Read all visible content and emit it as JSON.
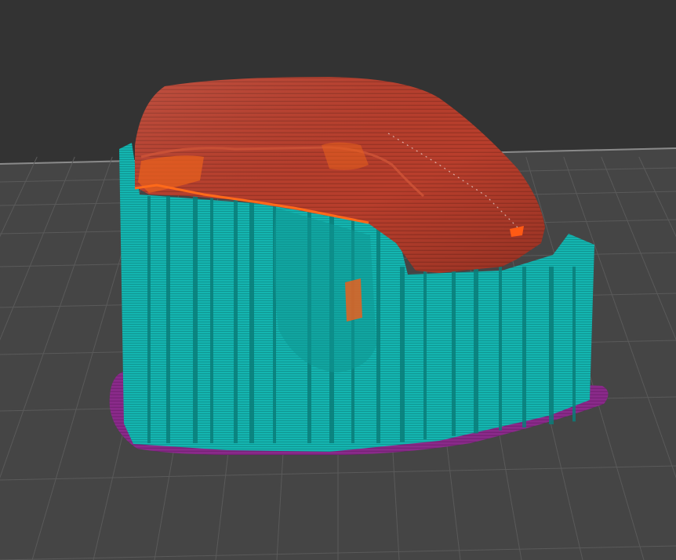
{
  "viewport": {
    "background_color": "#333333",
    "bed_color": "#454545",
    "grid_line_color": "#5a5a5a",
    "bed_edge_color": "#8a8a8a"
  },
  "toolpath_colors": {
    "skirt_brim": "#8a2a8a",
    "support": "#14b5b0",
    "outer_wall": "#b83e2c",
    "inner_wall": "#e8601e"
  }
}
